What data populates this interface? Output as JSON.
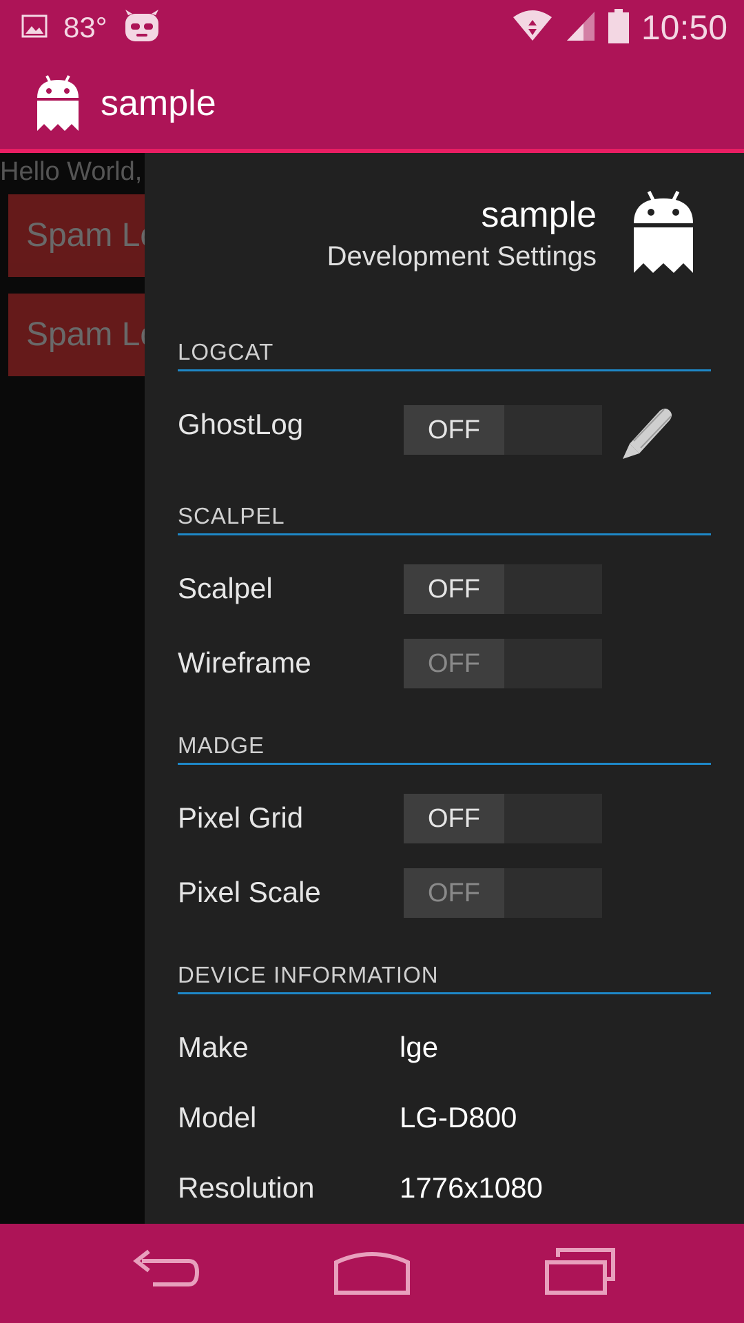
{
  "status_bar": {
    "temperature": "83°",
    "time": "10:50",
    "icons": [
      "gallery-notification-icon",
      "cyanogen-mascot-icon",
      "wifi-icon",
      "signal-icon",
      "battery-icon"
    ]
  },
  "action_bar": {
    "app_icon": "android-ghost-icon",
    "title": "sample"
  },
  "background": {
    "hello_text": "Hello World, DemoActivity",
    "buttons": [
      "Spam Logs",
      "Spam Logs"
    ]
  },
  "drawer": {
    "app_name": "sample",
    "subtitle": "Development Settings",
    "logo_icon": "android-ghost-icon",
    "sections": {
      "logcat": {
        "header": "LOGCAT",
        "ghostlog": {
          "label": "GhostLog",
          "state": "OFF"
        },
        "edit_icon": "pencil-icon"
      },
      "scalpel": {
        "header": "SCALPEL",
        "scalpel": {
          "label": "Scalpel",
          "state": "OFF"
        },
        "wireframe": {
          "label": "Wireframe",
          "state": "OFF"
        }
      },
      "madge": {
        "header": "MADGE",
        "pixel_grid": {
          "label": "Pixel Grid",
          "state": "OFF"
        },
        "pixel_scale": {
          "label": "Pixel Scale",
          "state": "OFF"
        }
      },
      "device_info": {
        "header": "DEVICE INFORMATION",
        "make": {
          "label": "Make",
          "value": "lge"
        },
        "model": {
          "label": "Model",
          "value": "LG-D800"
        },
        "resolution": {
          "label": "Resolution",
          "value": "1776x1080"
        }
      }
    }
  },
  "nav_bar": {
    "icons": [
      "back-icon",
      "home-icon",
      "recents-icon"
    ]
  },
  "colors": {
    "primary": "#ad1457",
    "accent_line": "#e91e63",
    "section_divider": "#1e88c8",
    "drawer_bg": "#212121"
  }
}
